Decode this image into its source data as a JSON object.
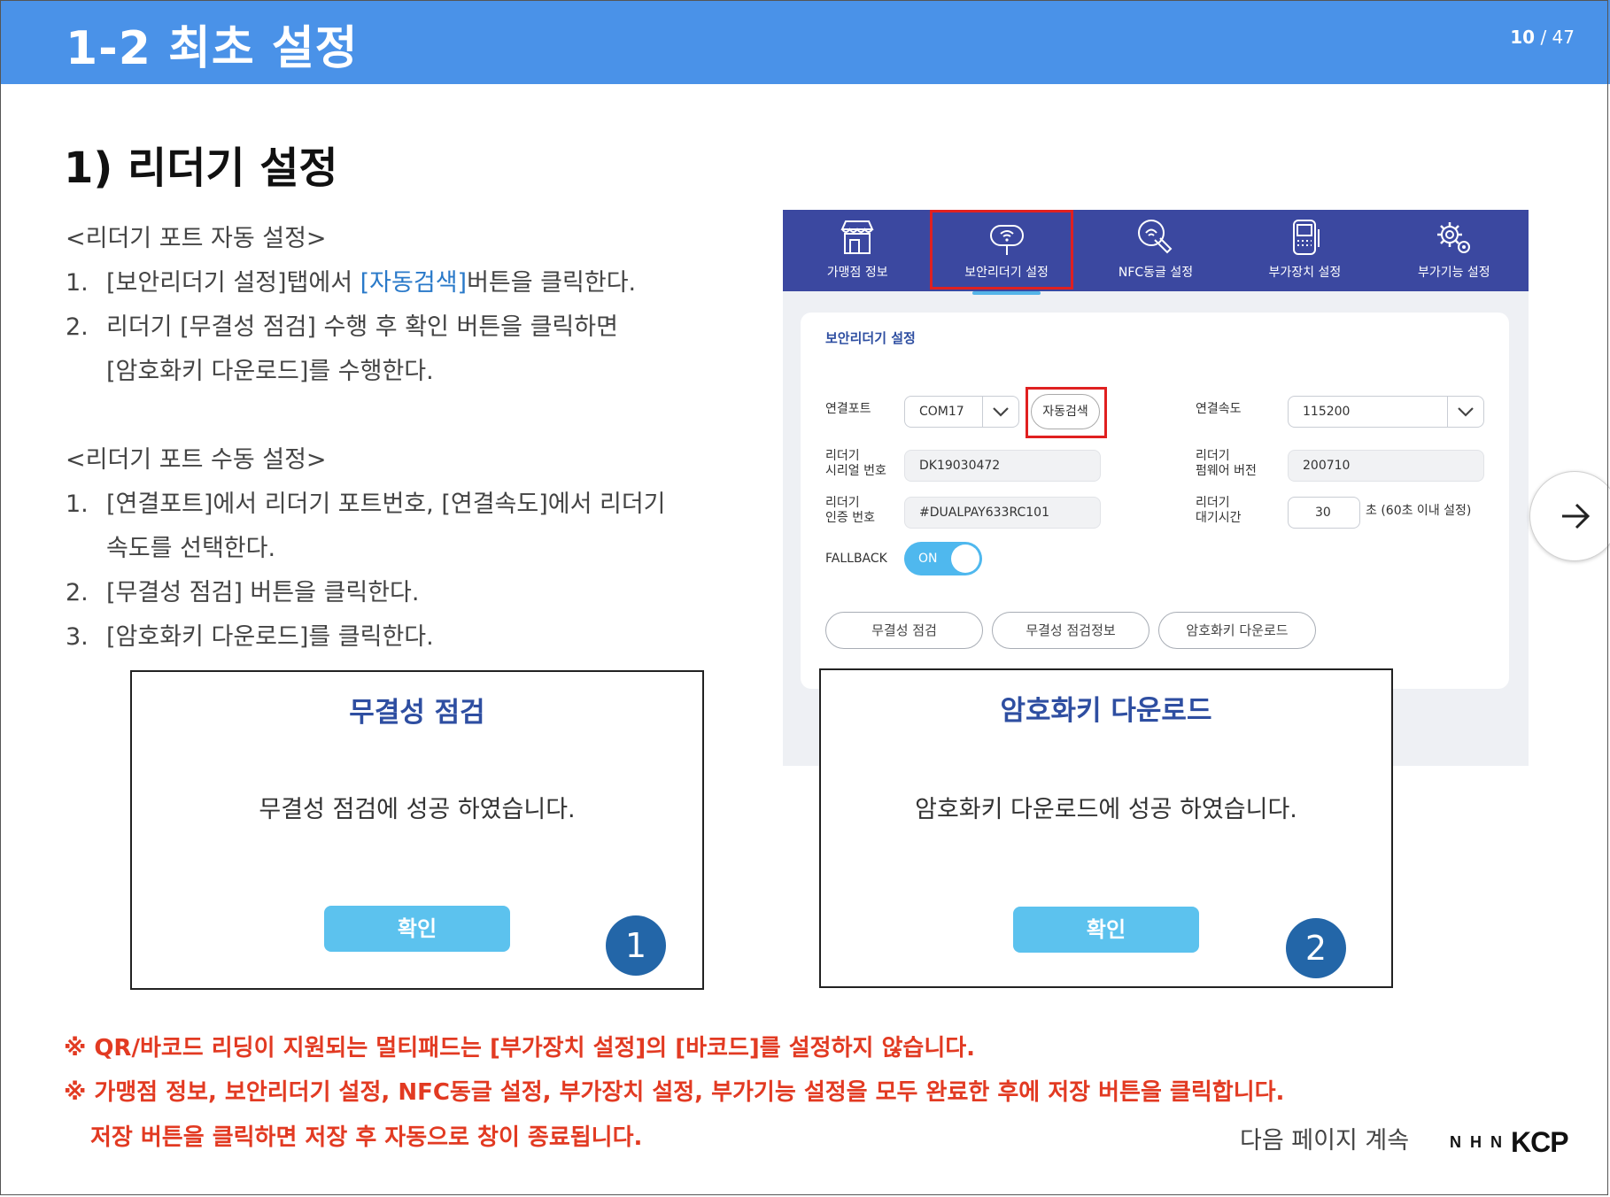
{
  "header": {
    "title": "1-2 최초 설정",
    "page_current": "10",
    "page_sep": " / ",
    "page_total": "47",
    "bg_color": "#4a92e8"
  },
  "section_title": "1) 리더기 설정",
  "auto_setup": {
    "heading": "<리더기 포트 자동 설정>",
    "steps": [
      {
        "num": "1.",
        "pre": "[보안리더기 설정]탭에서 ",
        "highlight": "[자동검색]",
        "post": "버튼을 클릭한다."
      },
      {
        "num": "2.",
        "line1": "리더기 [무결성 점검] 수행 후 확인 버튼을 클릭하면",
        "line2": "[암호화키 다운로드]를 수행한다."
      }
    ]
  },
  "manual_setup": {
    "heading": "<리더기 포트 수동 설정>",
    "steps": [
      {
        "num": "1.",
        "line1": "[연결포트]에서 리더기 포트번호, [연결속도]에서 리더기",
        "line2": "속도를 선택한다."
      },
      {
        "num": "2.",
        "text": "[무결성 점검] 버튼을 클릭한다."
      },
      {
        "num": "3.",
        "text": "[암호화키 다운로드]를 클릭한다."
      }
    ]
  },
  "app": {
    "tabs": [
      {
        "label": "가맹점 정보",
        "icon": "store-icon"
      },
      {
        "label": "보안리더기 설정",
        "icon": "card-reader-icon"
      },
      {
        "label": "NFC동글 설정",
        "icon": "nfc-icon"
      },
      {
        "label": "부가장치 설정",
        "icon": "device-icon"
      },
      {
        "label": "부가기능 설정",
        "icon": "gears-icon"
      }
    ],
    "panel_title": "보안리더기 설정",
    "port_label": "연결포트",
    "port_value": "COM17",
    "auto_search_label": "자동검색",
    "speed_label": "연결속도",
    "speed_value": "115200",
    "serial_label_1": "리더기",
    "serial_label_2": "시리얼 번호",
    "serial_value": "DK19030472",
    "firmware_label_1": "리더기",
    "firmware_label_2": "펌웨어 버전",
    "firmware_value": "200710",
    "auth_label_1": "리더기",
    "auth_label_2": "인증 번호",
    "auth_value": "#DUALPAY633RC101",
    "wait_label_1": "리더기",
    "wait_label_2": "대기시간",
    "wait_value": "30",
    "wait_note": "초 (60초 이내 설정)",
    "fallback_label": "FALLBACK",
    "fallback_state": "ON",
    "buttons": [
      "무결성 점검",
      "무결성 점검정보",
      "암호화키 다운로드"
    ],
    "accent_color": "#3b48a0"
  },
  "dialog1": {
    "title": "무결성 점검",
    "message": "무결성 점검에 성공 하였습니다.",
    "button": "확인",
    "badge": "1"
  },
  "dialog2": {
    "title": "암호화키 다운로드",
    "message": "암호화키 다운로드에 성공 하였습니다.",
    "button": "확인",
    "badge": "2"
  },
  "notes": {
    "line1": "※ QR/바코드 리딩이 지원되는 멀티패드는 [부가장치 설정]의 [바코드]를 설정하지 않습니다.",
    "line2": "※ 가맹점 정보, 보안리더기 설정, NFC동글 설정, 부가장치 설정, 부가기능 설정을 모두 완료한 후에 저장 버튼을 클릭합니다.",
    "line3": "저장 버튼을 클릭하면 저장 후 자동으로 창이 종료됩니다.",
    "color": "#e23a22"
  },
  "continue_text": "다음 페이지 계속",
  "logo": {
    "nhn": "NHN",
    "kcp": "KCP"
  }
}
